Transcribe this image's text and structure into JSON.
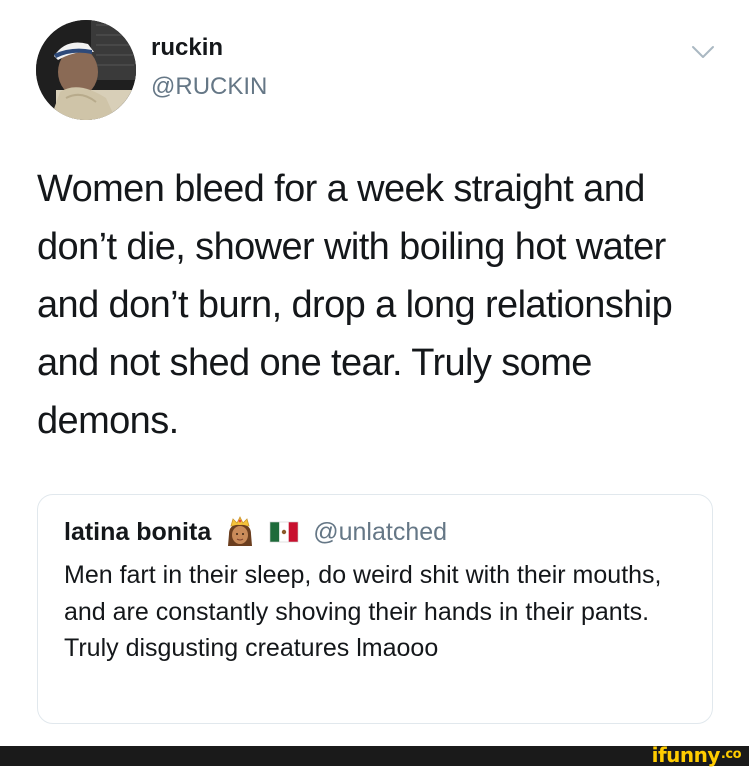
{
  "tweet": {
    "author": {
      "display_name": "ruckin",
      "handle": "@RUCKIN"
    },
    "menu_icon": "chevron-down-icon",
    "text": "Women bleed for a week straight and don’t die, shower with boiling hot water and don’t burn, drop a long relationship and not shed one tear. Truly some demons.",
    "quoted_tweet": {
      "display_name": "latina bonita",
      "emojis": [
        "princess-emoji",
        "mexico-flag-emoji"
      ],
      "handle": "@unlatched",
      "text": "Men fart in their sleep, do weird shit with their mouths, and are constantly shoving their hands in their pants. Truly disgusting creatures lmaooo"
    }
  },
  "watermark": {
    "text": "ifunny",
    "suffix": ".co",
    "color": "#ffcc00"
  },
  "colors": {
    "primary_text": "#14171a",
    "secondary_text": "#657786",
    "border": "#e1e8ed",
    "footer_bar": "#1a1a1a"
  }
}
